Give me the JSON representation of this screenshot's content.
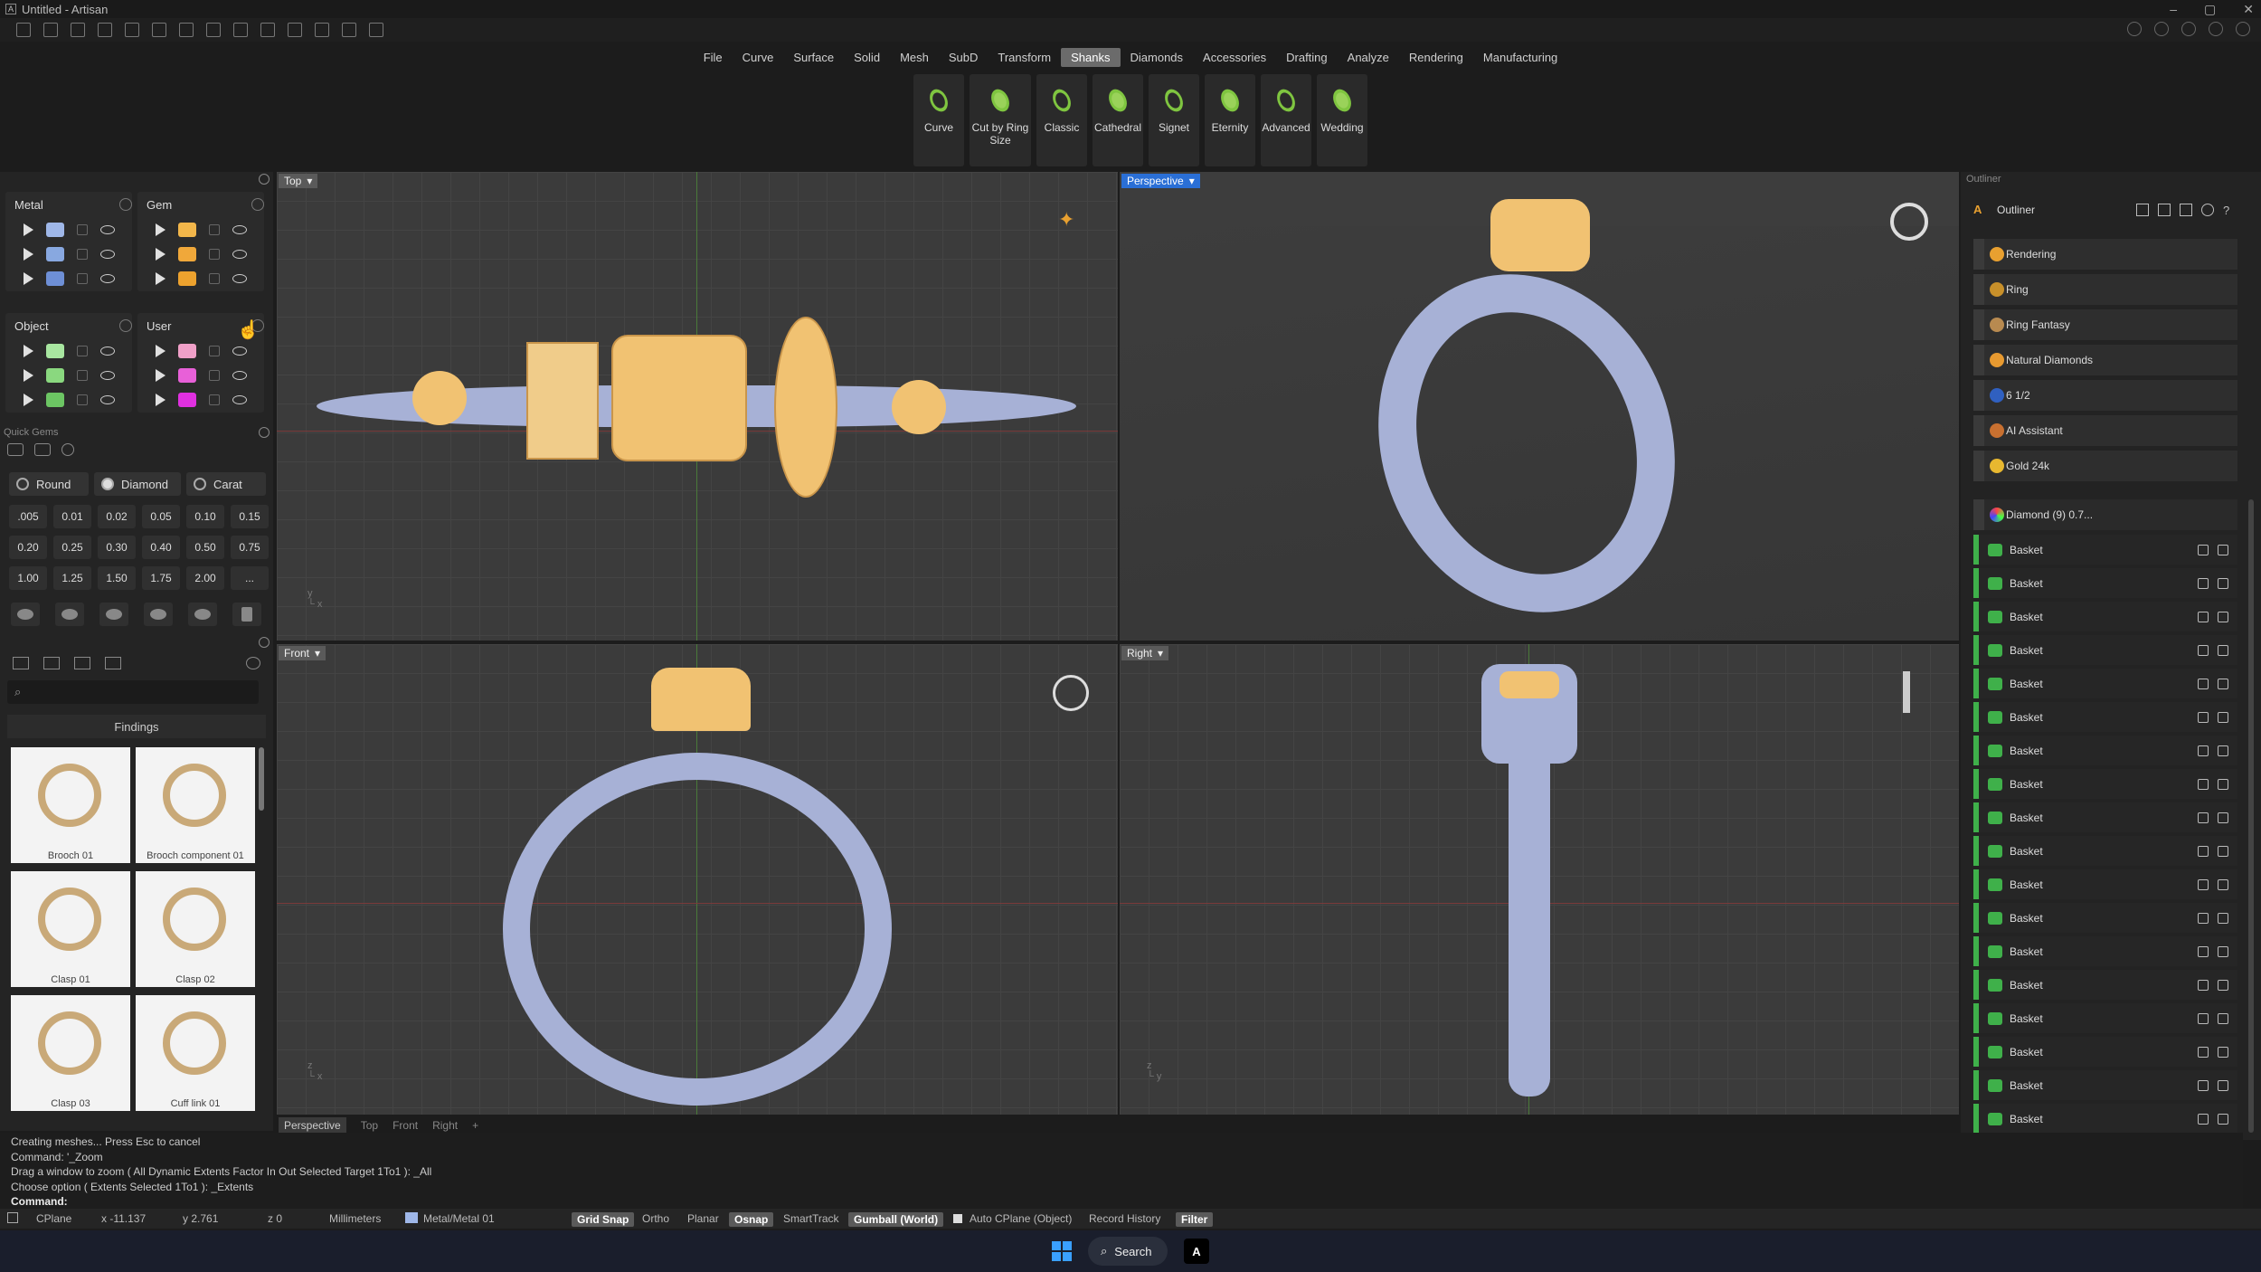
{
  "window": {
    "title": "Untitled - Artisan"
  },
  "menu": [
    "File",
    "Curve",
    "Surface",
    "Solid",
    "Mesh",
    "SubD",
    "Transform",
    "Shanks",
    "Diamonds",
    "Accessories",
    "Drafting",
    "Analyze",
    "Rendering",
    "Manufacturing"
  ],
  "menu_active": "Shanks",
  "ribbon": [
    {
      "label": "Curve"
    },
    {
      "label": "Cut by Ring Size"
    },
    {
      "label": "Classic"
    },
    {
      "label": "Cathedral"
    },
    {
      "label": "Signet"
    },
    {
      "label": "Eternity"
    },
    {
      "label": "Advanced"
    },
    {
      "label": "Wedding"
    }
  ],
  "layers": {
    "metal": {
      "title": "Metal",
      "colors": [
        "#9fb7e8",
        "#88a8e0",
        "#6e8fd6"
      ]
    },
    "gem": {
      "title": "Gem",
      "colors": [
        "#f2b64a",
        "#f0a83a",
        "#eda22e"
      ]
    },
    "object": {
      "title": "Object",
      "colors": [
        "#a8e6a0",
        "#8ad87f",
        "#6cc563"
      ]
    },
    "user": {
      "title": "User",
      "colors": [
        "#f0a0c8",
        "#e860d8",
        "#e030e0"
      ]
    }
  },
  "quick_gems": {
    "title": "Quick Gems",
    "shape_label": "Round",
    "type_label": "Diamond",
    "unit_label": "Carat",
    "carats": [
      ".005",
      "0.01",
      "0.02",
      "0.05",
      "0.10",
      "0.15",
      "0.20",
      "0.25",
      "0.30",
      "0.40",
      "0.50",
      "0.75",
      "1.00",
      "1.25",
      "1.50",
      "1.75",
      "2.00",
      "..."
    ]
  },
  "library": {
    "category": "Findings",
    "items": [
      "Brooch 01",
      "Brooch component 01",
      "Clasp 01",
      "Clasp 02",
      "Clasp 03",
      "Cuff link 01"
    ]
  },
  "viewports": {
    "top": "Top",
    "perspective": "Perspective",
    "front": "Front",
    "right": "Right"
  },
  "viewport_tabs": [
    "Perspective",
    "Top",
    "Front",
    "Right"
  ],
  "outliner": {
    "title": "Outliner",
    "panel_title": "Outliner",
    "top_items": [
      "Rendering",
      "Ring",
      "Ring Fantasy",
      "Natural Diamonds",
      "6 1/2",
      "AI Assistant",
      "Gold 24k"
    ],
    "group": "Diamond (9) 0.7...",
    "children": [
      "Basket",
      "Basket",
      "Basket",
      "Basket",
      "Basket",
      "Basket",
      "Basket",
      "Basket",
      "Basket",
      "Basket",
      "Basket",
      "Basket",
      "Basket",
      "Basket",
      "Basket",
      "Basket",
      "Basket",
      "Basket"
    ]
  },
  "command_history": [
    "Creating meshes... Press Esc to cancel",
    "Command: '_Zoom",
    "Drag a window to zoom ( All  Dynamic  Extents  Factor  In  Out  Selected  Target  1To1 ): _All",
    "Choose option ( Extents  Selected  1To1 ): _Extents"
  ],
  "command_prompt": "Command:",
  "status": {
    "cplane": "CPlane",
    "x": "x -11.137",
    "y": "y 2.761",
    "z": "z 0",
    "units": "Millimeters",
    "layer": "Metal/Metal 01",
    "toggles": [
      "Grid Snap",
      "Ortho",
      "Planar",
      "Osnap",
      "SmartTrack",
      "Gumball (World)",
      "Auto CPlane (Object)",
      "Record History",
      "Filter"
    ]
  },
  "taskbar": {
    "search": "Search"
  }
}
